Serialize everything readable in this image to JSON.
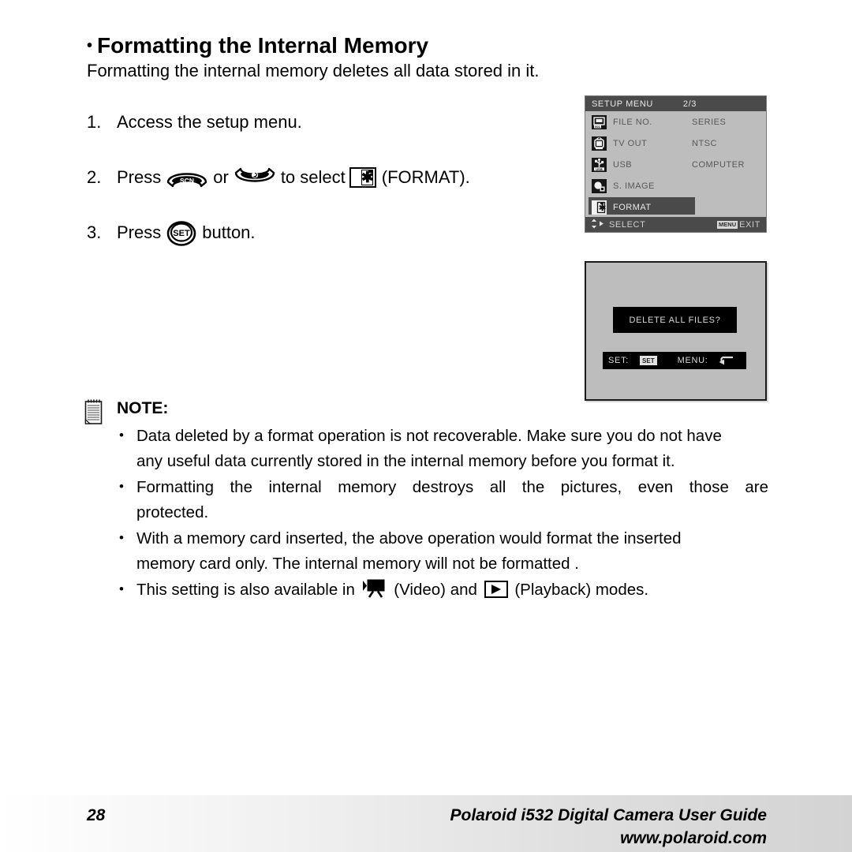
{
  "heading": {
    "bullet": "•",
    "title": "Formatting the Internal Memory",
    "subtitle": "Formatting the internal memory deletes all data stored in it."
  },
  "steps": [
    {
      "num": "1.",
      "before": "Access the setup menu.",
      "after": "",
      "mid": "",
      "tail": ""
    },
    {
      "num": "2.",
      "before": "Press",
      "mid": "or",
      "after": "to select",
      "tail": "(FORMAT).",
      "icon_a": "scn-button-icon",
      "icon_b": "self-timer-button-icon",
      "icon_c": "format-icon"
    },
    {
      "num": "3.",
      "before": "Press",
      "after": "button.",
      "mid": "",
      "tail": "",
      "icon_a": "set-button-icon"
    }
  ],
  "setup_menu": {
    "title": "SETUP MENU",
    "page_index": "2/3",
    "rows": [
      {
        "icon": "file-number-icon",
        "label": "FILE NO.",
        "value": "SERIES",
        "selected": false
      },
      {
        "icon": "tv-out-icon",
        "label": "TV OUT",
        "value": "NTSC",
        "selected": false
      },
      {
        "icon": "usb-icon",
        "label": "USB",
        "value": "COMPUTER",
        "selected": false
      },
      {
        "icon": "startup-image-icon",
        "label": "S. IMAGE",
        "value": "",
        "selected": false
      },
      {
        "icon": "format-icon",
        "label": "FORMAT",
        "value": "",
        "selected": true
      }
    ],
    "bottom_bar": {
      "select_label": "SELECT",
      "select_icon": "dpad-arrows-icon",
      "menu_chip": "MENU",
      "exit_label": "EXIT"
    },
    "colors": {
      "lcd_background": "#bdbdbd",
      "bar_background": "#4a4a4a",
      "highlight": "#4a4a4a",
      "text_dim": "#585858",
      "text_bright": "#e9e9e9"
    }
  },
  "confirm_dialog": {
    "message": "DELETE ALL FILES?",
    "set_label": "SET:",
    "set_chip": "SET",
    "menu_label": "MENU:",
    "back_arrow": "↩",
    "colors": {
      "lcd_background": "#bdbdbd",
      "box_background": "#000000",
      "box_text": "#dadada"
    }
  },
  "note": {
    "icon": "notepad-icon",
    "title": "NOTE:",
    "bullet": "•",
    "items": [
      {
        "lines": [
          "Data deleted by a format operation is not recoverable. Make sure you do not have",
          "any useful data currently stored in the internal memory before you format it."
        ]
      },
      {
        "lines": [
          "Formatting the internal memory destroys all the pictures, even those are",
          "protected."
        ],
        "justify_first": true
      },
      {
        "lines": [
          "With a memory card inserted, the above operation would format the inserted",
          "memory card only. The internal memory will not be formatted ."
        ]
      },
      {
        "inline": true,
        "part_a": "This setting is also available in",
        "icon_a": "video-camera-icon",
        "part_b": "(Video) and",
        "icon_b": "playback-icon",
        "part_c": "(Playback) modes."
      }
    ]
  },
  "footer": {
    "page_number": "28",
    "guide_title": "Polaroid i532 Digital Camera User Guide",
    "website": "www.polaroid.com"
  }
}
